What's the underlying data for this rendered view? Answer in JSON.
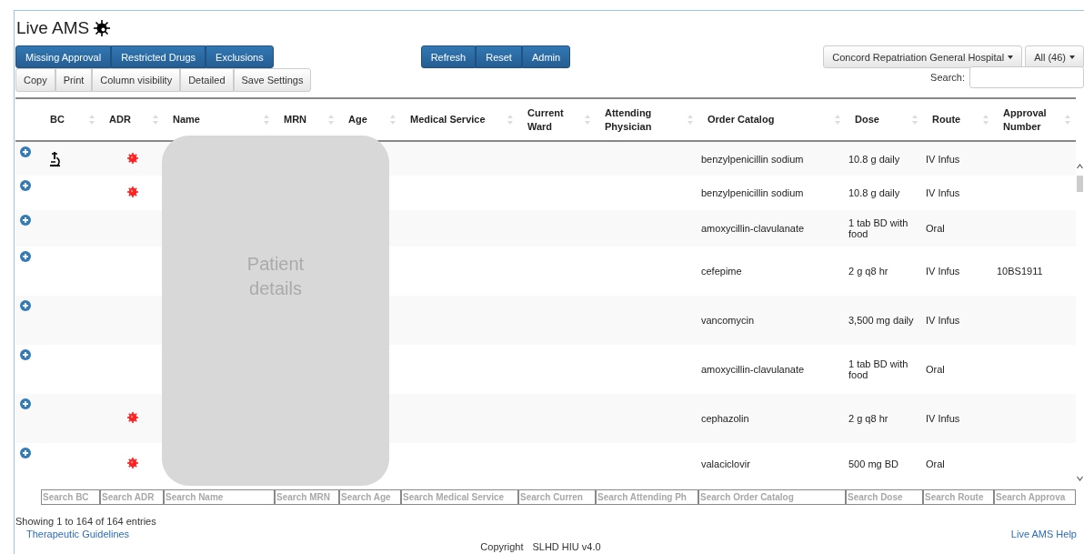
{
  "title": "Live AMS",
  "filter_buttons": [
    "Missing Approval",
    "Restricted Drugs",
    "Exclusions"
  ],
  "action_buttons": [
    "Refresh",
    "Reset",
    "Admin"
  ],
  "hospital_dropdown": "Concord Repatriation General Hospital",
  "count_dropdown": "All (46)",
  "table_tools": [
    "Copy",
    "Print",
    "Column visibility",
    "Detailed",
    "Save Settings"
  ],
  "search": {
    "label": "Search:"
  },
  "table": {
    "columns": [
      {
        "lines": [
          "BC"
        ]
      },
      {
        "lines": [
          "ADR"
        ]
      },
      {
        "lines": [
          "Name"
        ]
      },
      {
        "lines": [
          "MRN"
        ]
      },
      {
        "lines": [
          "Age"
        ]
      },
      {
        "lines": [
          "Medical Service"
        ]
      },
      {
        "lines": [
          "Current",
          "Ward"
        ]
      },
      {
        "lines": [
          "Attending",
          "Physician"
        ]
      },
      {
        "lines": [
          "Order Catalog"
        ]
      },
      {
        "lines": [
          "Dose"
        ]
      },
      {
        "lines": [
          "Route"
        ]
      },
      {
        "lines": [
          "Approval",
          "Number"
        ]
      }
    ],
    "rows": [
      {
        "bc": true,
        "adr": true,
        "order": "benzylpenicillin sodium",
        "dose": "10.8 g daily",
        "route": "IV Infus"
      },
      {
        "bc": false,
        "adr": true,
        "order": "benzylpenicillin sodium",
        "dose": "10.8 g daily",
        "route": "IV Infus"
      },
      {
        "bc": false,
        "adr": false,
        "order": "amoxycillin-clavulanate",
        "dose": "1 tab BD with food",
        "route": "Oral"
      },
      {
        "bc": false,
        "adr": false,
        "order": "cefepime",
        "dose": "2 g q8 hr",
        "route": "IV Infus",
        "approval": "10BS1911"
      },
      {
        "bc": false,
        "adr": false,
        "order": "vancomycin",
        "dose": "3,500 mg daily",
        "route": "IV Infus"
      },
      {
        "bc": false,
        "adr": false,
        "order": "amoxycillin-clavulanate",
        "dose": "1 tab BD with food",
        "route": "Oral"
      },
      {
        "bc": false,
        "adr": true,
        "order": "cephazolin",
        "dose": "2 g q8 hr",
        "route": "IV Infus"
      },
      {
        "bc": false,
        "adr": true,
        "order": "valaciclovir",
        "dose": "500 mg BD",
        "route": "Oral"
      }
    ],
    "filters": [
      {
        "placeholder": "Search BC"
      },
      {
        "placeholder": "Search ADR"
      },
      {
        "placeholder": "Search Name"
      },
      {
        "placeholder": "Search MRN"
      },
      {
        "placeholder": "Search Age"
      },
      {
        "placeholder": "Search Medical Service"
      },
      {
        "placeholder": "Search Curren"
      },
      {
        "placeholder": "Search Attending Ph"
      },
      {
        "placeholder": "Search Order Catalog"
      },
      {
        "placeholder": "Search Dose"
      },
      {
        "placeholder": "Search Route"
      },
      {
        "placeholder": "Search Approva"
      }
    ]
  },
  "overlay": "Patient details",
  "entries_info": "Showing 1 to 164 of 164 entries",
  "links": [
    "Therapeutic Guidelines",
    "Live AMS Help"
  ],
  "footer": [
    "Copyright",
    "SLHD HIU v4.0"
  ]
}
